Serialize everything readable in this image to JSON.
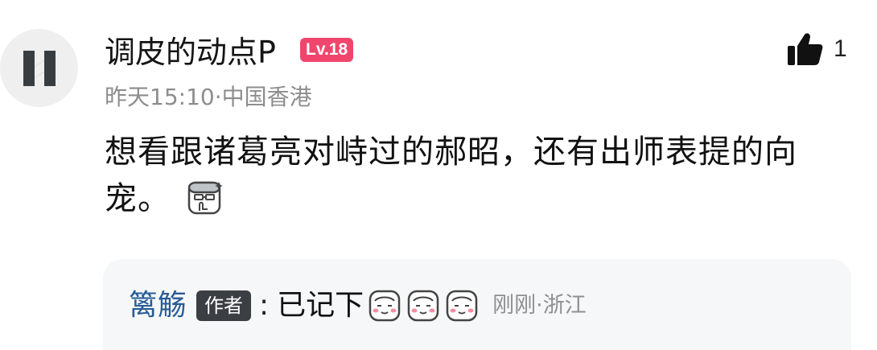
{
  "comment": {
    "avatar_icon": "logo-avatar-icon",
    "username": "调皮的动点P",
    "level": "Lv.18",
    "level_color": "#f0466e",
    "like_icon": "thumbs-up-icon",
    "like_count": "1",
    "meta": "昨天15:10·中国香港",
    "content": "想看跟诸葛亮对峙过的郝昭，还有出师表提的向宠。",
    "content_emoji": "sticker-emoji-icon"
  },
  "reply": {
    "name": "篱觞",
    "name_color": "#275c96",
    "author_tag": "作者",
    "colon": ":",
    "text": "已记下",
    "stickers": [
      "sticker-face-icon",
      "sticker-face-icon",
      "sticker-face-icon"
    ],
    "meta": "刚刚·浙江"
  }
}
